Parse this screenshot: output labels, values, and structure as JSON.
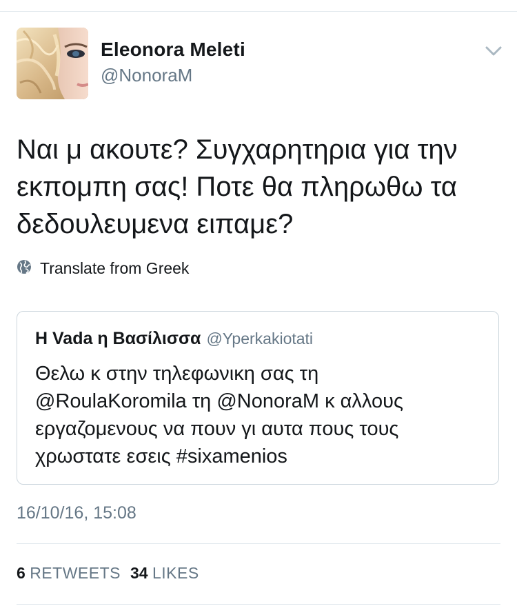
{
  "user": {
    "display_name": "Eleonora Meleti",
    "handle": "@NonoraM"
  },
  "tweet": {
    "lines": [
      "Ναι μ ακουτε? Συγχαρητηρια για την",
      "εκπομπη σας! Ποτε θα πληρωθω τα",
      "δεδουλευμενα ειπαμε?"
    ],
    "translate_label": "Translate from Greek",
    "timestamp": "16/10/16, 15:08"
  },
  "quoted_tweet": {
    "display_name": "Η Vada η Βασίλισσα",
    "handle": "@Yperkakiotati",
    "lines": [
      "Θελω κ στην τηλεφωνικη σας τη",
      "@RoulaKoromila τη @NonoraM κ αλλους",
      "εργαζομενους να πουν γι αυτα πους τους",
      "χρωστατε εσεις #sixamenios"
    ]
  },
  "stats": {
    "retweets_count": "6",
    "retweets_label": "RETWEETS",
    "likes_count": "34",
    "likes_label": "LIKES"
  },
  "icons": {
    "chevron": "chevron-down-icon",
    "globe": "globe-icon"
  },
  "colors": {
    "text_primary": "#14171a",
    "text_secondary": "#657786",
    "divider": "#e1e8ed",
    "quote_border": "#ccd6dd"
  }
}
